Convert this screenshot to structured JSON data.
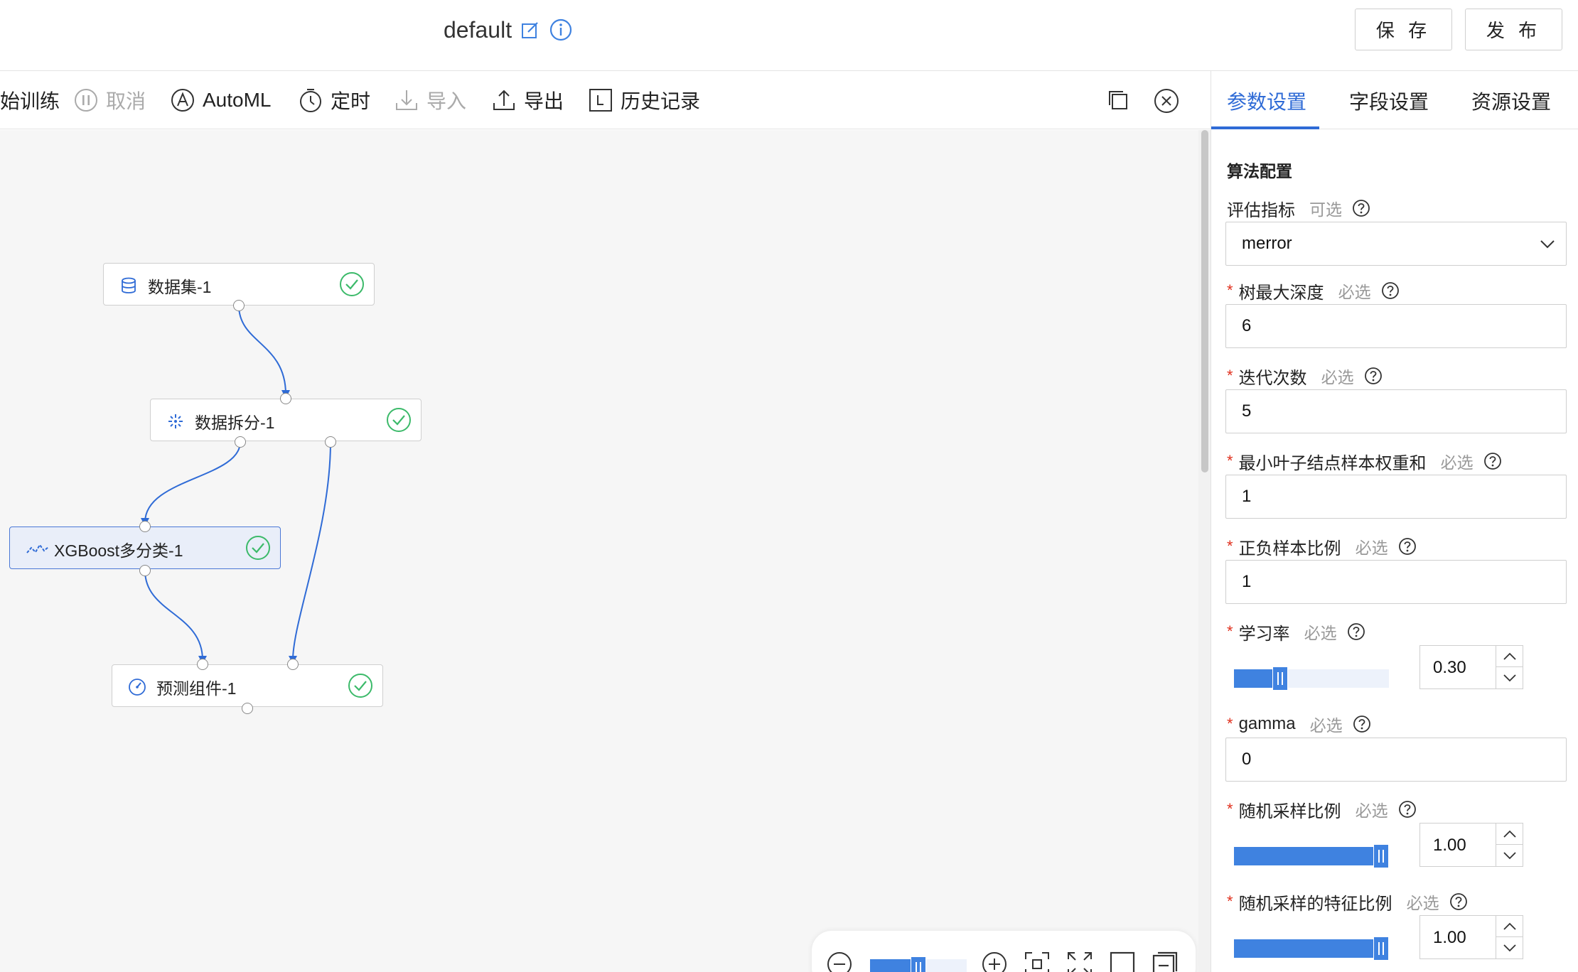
{
  "header": {
    "title": "default",
    "save_label": "保 存",
    "publish_label": "发 布"
  },
  "toolbar": {
    "items": [
      {
        "label": "始训练",
        "icon": "play-icon",
        "disabled": false
      },
      {
        "label": "取消",
        "icon": "pause-circle-icon",
        "disabled": true
      },
      {
        "label": "AutoML",
        "icon": "automl-icon",
        "disabled": false
      },
      {
        "label": "定时",
        "icon": "timer-icon",
        "disabled": false
      },
      {
        "label": "导入",
        "icon": "import-icon",
        "disabled": true
      },
      {
        "label": "导出",
        "icon": "export-icon",
        "disabled": false
      },
      {
        "label": "历史记录",
        "icon": "history-icon",
        "disabled": false
      }
    ]
  },
  "canvas": {
    "nodes": [
      {
        "id": "dataset",
        "label": "数据集-1",
        "icon": "database-icon",
        "status": "success"
      },
      {
        "id": "split",
        "label": "数据拆分-1",
        "icon": "split-icon",
        "status": "success"
      },
      {
        "id": "xgboost",
        "label": "XGBoost多分类-1",
        "icon": "algorithm-icon",
        "status": "success",
        "selected": true
      },
      {
        "id": "predict",
        "label": "预测组件-1",
        "icon": "predict-icon",
        "status": "success"
      }
    ],
    "edges": [
      {
        "from": "dataset",
        "to": "split"
      },
      {
        "from": "split",
        "to": "xgboost"
      },
      {
        "from": "split",
        "to": "predict"
      },
      {
        "from": "xgboost",
        "to": "predict"
      }
    ],
    "zoom_level": 0.5
  },
  "panel": {
    "tabs": [
      {
        "label": "参数设置",
        "active": true
      },
      {
        "label": "字段设置",
        "active": false
      },
      {
        "label": "资源设置",
        "active": false
      }
    ],
    "section_title": "算法配置",
    "fields": [
      {
        "label": "评估指标",
        "tag": "可选",
        "required": false,
        "type": "select",
        "value": "merror"
      },
      {
        "label": "树最大深度",
        "tag": "必选",
        "required": true,
        "type": "input",
        "value": "6"
      },
      {
        "label": "迭代次数",
        "tag": "必选",
        "required": true,
        "type": "input",
        "value": "5"
      },
      {
        "label": "最小叶子结点样本权重和",
        "tag": "必选",
        "required": true,
        "type": "input",
        "value": "1"
      },
      {
        "label": "正负样本比例",
        "tag": "必选",
        "required": true,
        "type": "input",
        "value": "1"
      },
      {
        "label": "学习率",
        "tag": "必选",
        "required": true,
        "type": "slider",
        "value": "0.30",
        "fraction": 0.3
      },
      {
        "label": "gamma",
        "tag": "必选",
        "required": true,
        "type": "input",
        "value": "0"
      },
      {
        "label": "随机采样比例",
        "tag": "必选",
        "required": true,
        "type": "slider",
        "value": "1.00",
        "fraction": 1.0
      },
      {
        "label": "随机采样的特征比例",
        "tag": "必选",
        "required": true,
        "type": "slider",
        "value": "1.00",
        "fraction": 1.0
      }
    ]
  },
  "colors": {
    "accent": "#2f6bd6",
    "success": "#3cba6a",
    "required": "#e0301e"
  }
}
